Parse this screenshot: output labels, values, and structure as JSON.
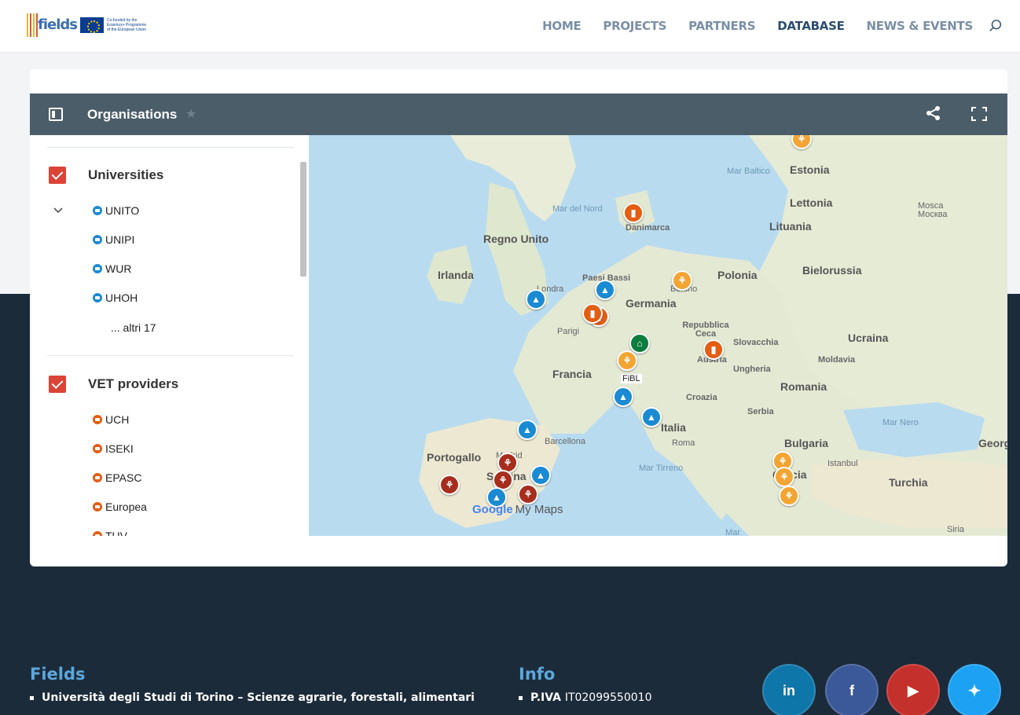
{
  "header": {
    "logo_text": "fields",
    "eu_text": "Co-funded by the Erasmus+ Programme of the European Union",
    "nav": [
      {
        "label": "HOME",
        "active": false
      },
      {
        "label": "PROJECTS",
        "active": false
      },
      {
        "label": "PARTNERS",
        "active": false
      },
      {
        "label": "DATABASE",
        "active": true
      },
      {
        "label": "NEWS & EVENTS",
        "active": false
      }
    ]
  },
  "map_card": {
    "title": "Organisations",
    "layers": [
      {
        "name": "Universities",
        "checked": true,
        "icon_color": "#1a8ad3",
        "items": [
          "UNITO",
          "UNIPI",
          "WUR",
          "UHOH"
        ],
        "more": "... altri 17"
      },
      {
        "name": "VET providers",
        "checked": true,
        "icon_color": "#e35d12",
        "items": [
          "UCH",
          "ISEKI",
          "EPASC",
          "Europea",
          "TUV"
        ]
      }
    ],
    "map_labels": {
      "estonia": "Estonia",
      "mar_baltico": "Mar Baltico",
      "lettonia": "Lettonia",
      "mosca": "Mosca",
      "mosca_ru": "Москва",
      "mar_del_nord": "Mar del Nord",
      "danimarca": "Danimarca",
      "lituania": "Lituania",
      "regno_unito": "Regno Unito",
      "irlanda": "Irlanda",
      "bielorussia": "Bielorussia",
      "paesi_bassi": "Paesi Bassi",
      "polonia": "Polonia",
      "berlino": "Berlino",
      "londra": "Londra",
      "germania": "Germania",
      "parigi": "Parigi",
      "repubblica_ceca": "Repubblica Ceca",
      "slovacchia": "Slovacchia",
      "ucraina": "Ucraina",
      "austria": "Austria",
      "moldavia": "Moldavia",
      "ungheria": "Ungheria",
      "francia": "Francia",
      "fibl": "FiBL",
      "romania": "Romania",
      "croazia": "Croazia",
      "serbia": "Serbia",
      "italia": "Italia",
      "mar_nero": "Mar Nero",
      "barcellona": "Barcellona",
      "roma": "Roma",
      "bulgaria": "Bulgaria",
      "georgia": "Georg",
      "portogallo": "Portogallo",
      "madrid": "Madrid",
      "istanbul": "Istanbul",
      "spagna": "Spagna",
      "mar_tirreno": "Mar Tirreno",
      "grecia": "Grecia",
      "turchia": "Turchia",
      "siria": "Siria",
      "mar": "Mar"
    },
    "google_brand": "Google",
    "my_maps": "My Maps"
  },
  "footer": {
    "fields_heading": "Fields",
    "fields_line": "Università degli Studi di Torino – Scienze agrarie, forestali, alimentari",
    "info_heading": "Info",
    "info_label": "P.IVA",
    "info_value": "IT02099550010",
    "social": [
      {
        "name": "linkedin",
        "label": "in",
        "color": "#0e76a8"
      },
      {
        "name": "facebook",
        "label": "f",
        "color": "#3b5998"
      },
      {
        "name": "youtube",
        "label": "▶",
        "color": "#c4302b"
      },
      {
        "name": "twitter",
        "label": "🐦",
        "color": "#1da1f2"
      }
    ]
  }
}
